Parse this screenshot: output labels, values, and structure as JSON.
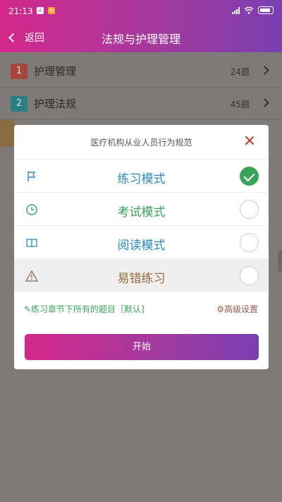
{
  "statusbar": {
    "time": "21:13"
  },
  "header": {
    "back_label": "返回",
    "title": "法规与护理管理"
  },
  "chapters": [
    {
      "num": "1",
      "name": "护理管理",
      "count": "24题",
      "color": "#a8443c"
    },
    {
      "num": "2",
      "name": "护理法规",
      "count": "45题",
      "color": "#2a7f86"
    }
  ],
  "modal": {
    "title": "医疗机构从业人员行为规范",
    "modes": [
      {
        "label": "练习模式",
        "icon": "flag-icon",
        "color": "#2a8bc0",
        "selected": true
      },
      {
        "label": "考试模式",
        "icon": "clock-icon",
        "color": "#3aa35b",
        "selected": false
      },
      {
        "label": "阅读模式",
        "icon": "book-icon",
        "color": "#2a8bc0",
        "selected": false
      },
      {
        "label": "易错练习",
        "icon": "warning-icon",
        "color": "#9c6a3a",
        "selected": false
      }
    ],
    "note": "✎练习章节下所有的题目［默认]",
    "advanced": "⚙高级设置",
    "start": "开始"
  }
}
